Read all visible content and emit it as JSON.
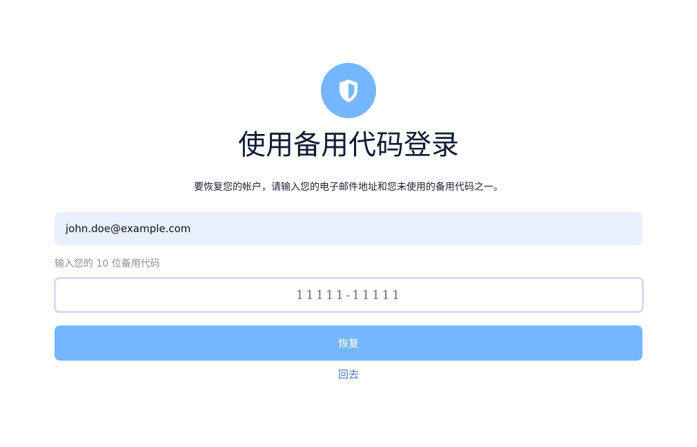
{
  "logo": {
    "icon": "shield-icon",
    "background": "#75b7ff"
  },
  "title": "使用备用代码登录",
  "subtitle": "要恢复您的帐户，请输入您的电子邮件地址和您未使用的备用代码之一。",
  "email_field": {
    "value": "john.doe@example.com"
  },
  "code_field": {
    "label": "输入您的 10 位备用代码",
    "value": "11111-11111"
  },
  "submit_button": {
    "label": "恢复",
    "color": "#75b7ff"
  },
  "back_link": {
    "label": "回去",
    "color": "#4a78c4"
  }
}
